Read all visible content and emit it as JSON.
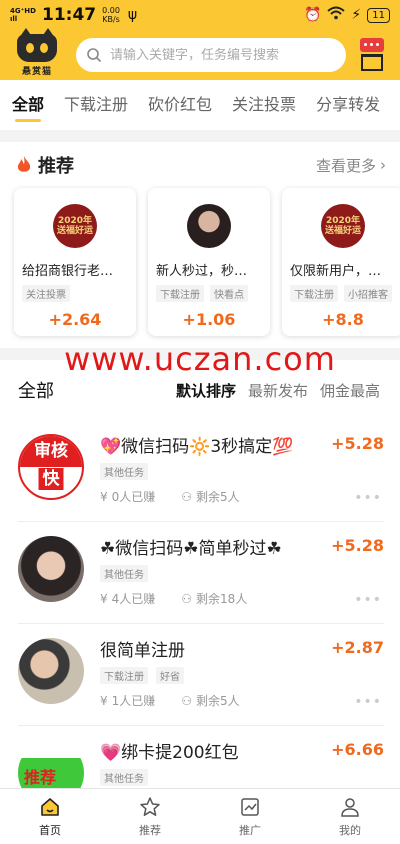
{
  "status_bar": {
    "network": "4G⁺HD",
    "signal": "ıll",
    "time": "11:47",
    "speed_value": "0.00",
    "speed_unit": "KB/s",
    "battery": "11"
  },
  "header": {
    "logo_text": "悬赏猫",
    "search_placeholder": "请输入关键字，任务编号搜索"
  },
  "tabs": [
    {
      "label": "全部"
    },
    {
      "label": "下载注册"
    },
    {
      "label": "砍价红包"
    },
    {
      "label": "关注投票"
    },
    {
      "label": "分享转发"
    }
  ],
  "recommend": {
    "title": "推荐",
    "more_label": "查看更多",
    "cards": [
      {
        "title": "给招商银行老…",
        "tags": [
          "关注投票"
        ],
        "reward": "+2.64",
        "thumb_text": "2020年 送福好运",
        "thumb_color": "#8e1a1a"
      },
      {
        "title": "新人秒过，秒…",
        "tags": [
          "下载注册",
          "快看点"
        ],
        "reward": "+1.06",
        "thumb_text": "",
        "thumb_color": "#3a2a2a"
      },
      {
        "title": "仅限新用户，…",
        "tags": [
          "下载注册",
          "小招推客"
        ],
        "reward": "+8.8",
        "thumb_text": "2020年 送福好运",
        "thumb_color": "#8e1a1a"
      }
    ]
  },
  "watermark": "www.uczan.com",
  "all_list": {
    "title": "全部",
    "sorts": [
      {
        "label": "默认排序"
      },
      {
        "label": "最新发布"
      },
      {
        "label": "佣金最高"
      }
    ],
    "items": [
      {
        "title": "💖微信扫码🔆3秒搞定💯",
        "tags": [
          "其他任务"
        ],
        "earned": "0人已赚",
        "remaining": "剩余5人",
        "reward": "+5.28",
        "avatar_text_1": "审核",
        "avatar_text_2": "快"
      },
      {
        "title": "☘微信扫码☘简单秒过☘",
        "tags": [
          "其他任务"
        ],
        "earned": "4人已赚",
        "remaining": "剩余18人",
        "reward": "+5.28"
      },
      {
        "title": "很简单注册",
        "tags": [
          "下载注册",
          "好省"
        ],
        "earned": "1人已赚",
        "remaining": "剩余5人",
        "reward": "+2.87"
      },
      {
        "title": "💗绑卡提200红包",
        "tags": [
          "其他任务"
        ],
        "earned": "",
        "remaining": "",
        "reward": "+6.66",
        "avatar_text_1": "推荐"
      }
    ]
  },
  "bottom_nav": [
    {
      "label": "首页"
    },
    {
      "label": "推荐"
    },
    {
      "label": "推广"
    },
    {
      "label": "我的"
    }
  ],
  "colors": {
    "brand_yellow": "#fbc834",
    "reward_orange": "#f06a1e",
    "watermark_red": "#e01818"
  }
}
